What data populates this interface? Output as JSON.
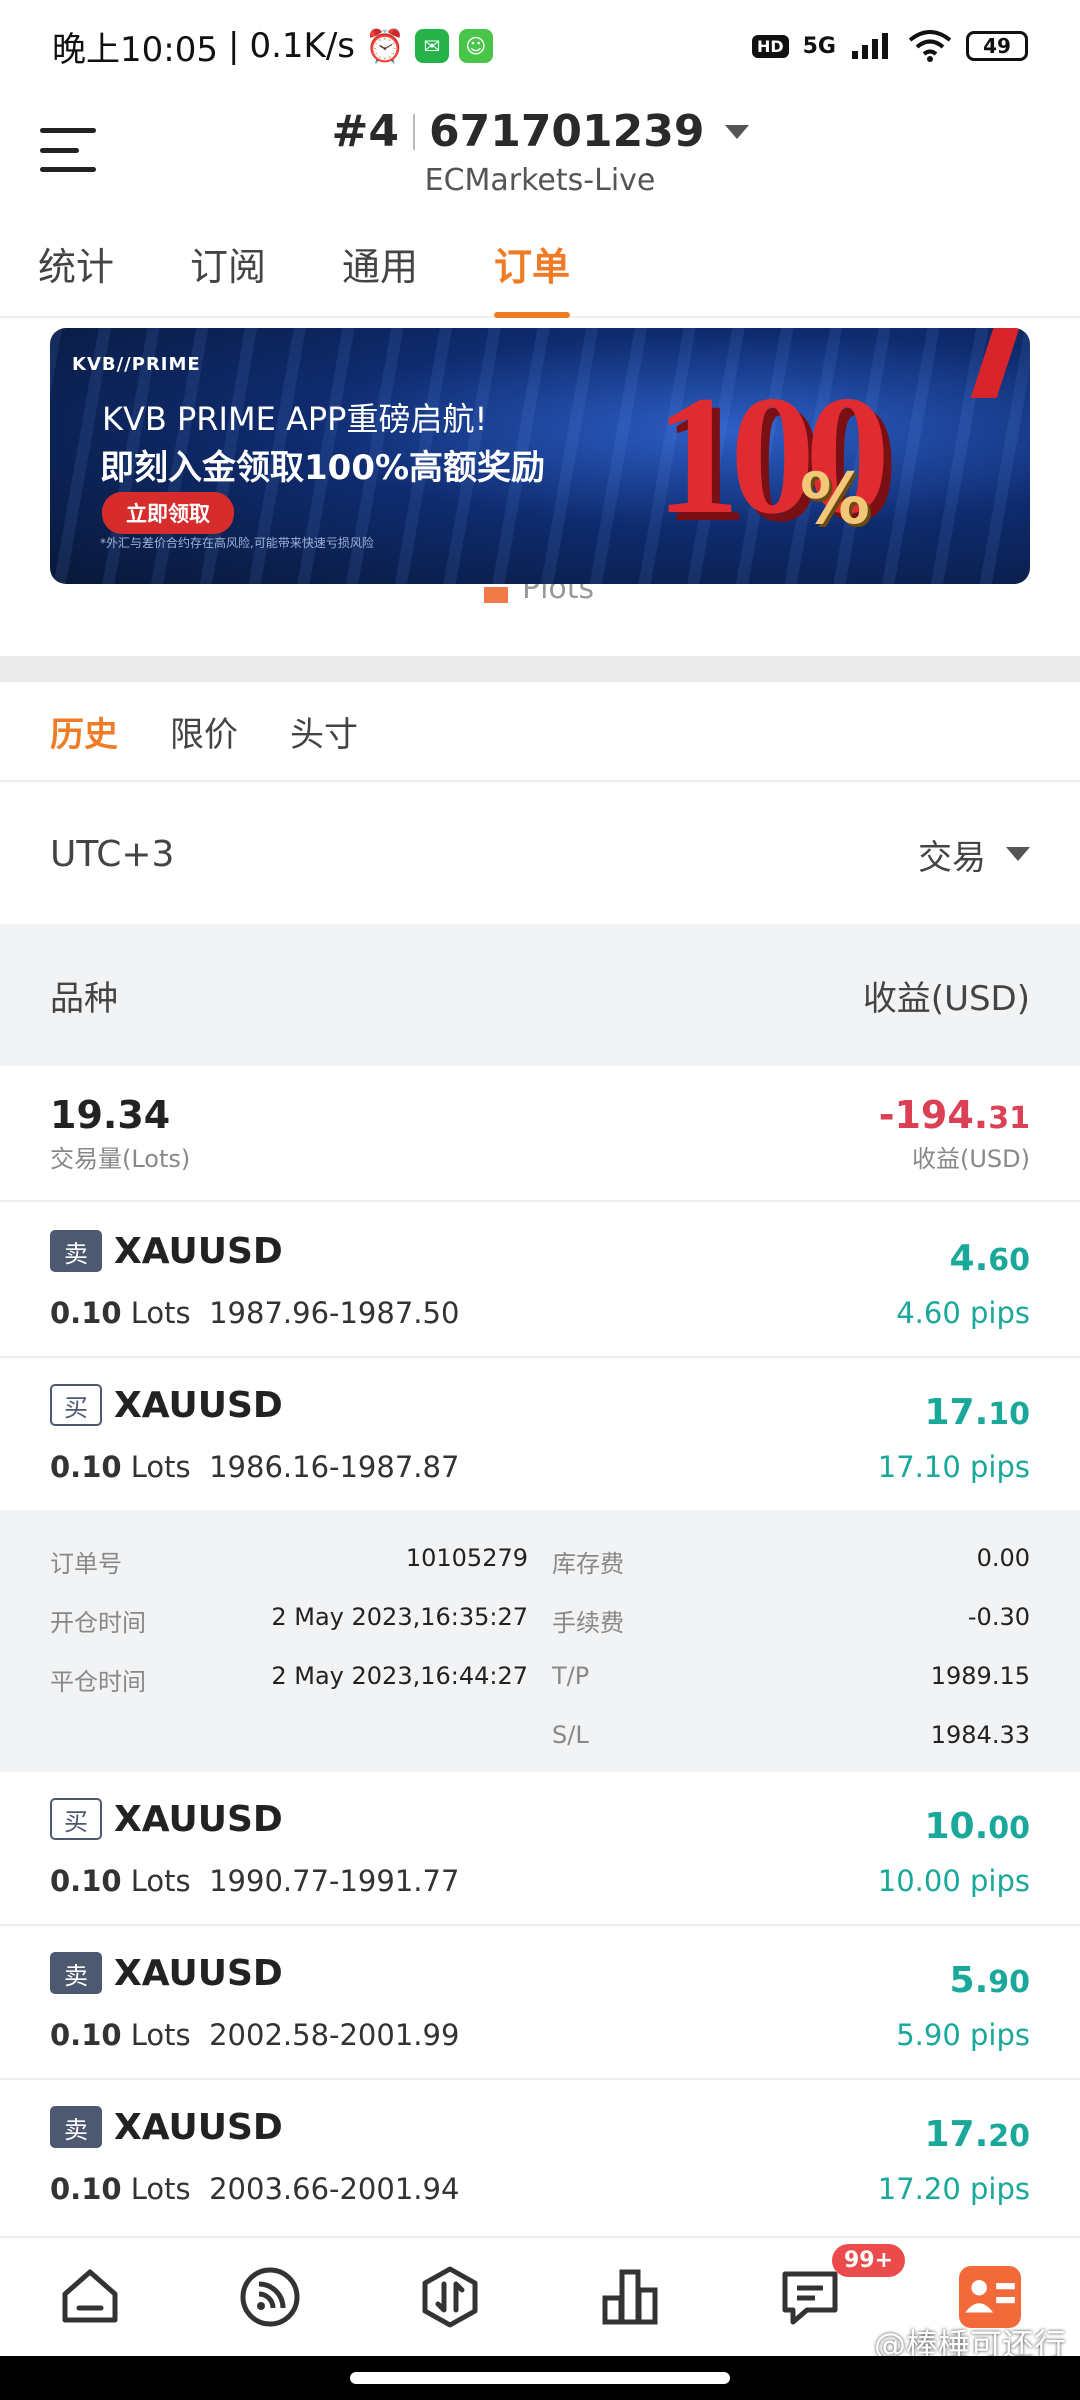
{
  "status_bar": {
    "time": "晚上10:05",
    "speed": "0.1K/s",
    "hd": "HD",
    "network": "5G",
    "battery": "49"
  },
  "header": {
    "account_prefix": "#4",
    "account_number": "671701239",
    "server": "ECMarkets-Live"
  },
  "tabs": [
    "统计",
    "订阅",
    "通用",
    "订单"
  ],
  "banner": {
    "logo": "KVB//PRIME",
    "line1": "KVB PRIME APP重磅启航!",
    "line2": "即刻入金领取100%高额奖励",
    "button": "立即领取",
    "note": "*外汇与差价合约存在高风险,可能带来快速亏损风险",
    "big_number": "100",
    "percent": "%"
  },
  "legend_label": "Plots",
  "subtabs": [
    "历史",
    "限价",
    "头寸"
  ],
  "filter": {
    "timezone": "UTC+3",
    "type_select": "交易"
  },
  "columns": {
    "left": "品种",
    "right": "收益(USD)"
  },
  "summary": {
    "volume": "19.34",
    "volume_label": "交易量(Lots)",
    "profit_main": "-194.",
    "profit_decimals": "31",
    "profit_label": "收益(USD)"
  },
  "orders": [
    {
      "side": "卖",
      "symbol": "XAUUSD",
      "lots": "0.10",
      "lots_unit": "Lots",
      "prices": "1987.96-1987.50",
      "profit_main": "4.",
      "profit_decimals": "60",
      "pips": "4.60 pips"
    },
    {
      "side": "买",
      "symbol": "XAUUSD",
      "lots": "0.10",
      "lots_unit": "Lots",
      "prices": "1986.16-1987.87",
      "profit_main": "17.",
      "profit_decimals": "10",
      "pips": "17.10 pips"
    },
    {
      "side": "买",
      "symbol": "XAUUSD",
      "lots": "0.10",
      "lots_unit": "Lots",
      "prices": "1990.77-1991.77",
      "profit_main": "10.",
      "profit_decimals": "00",
      "pips": "10.00 pips"
    },
    {
      "side": "卖",
      "symbol": "XAUUSD",
      "lots": "0.10",
      "lots_unit": "Lots",
      "prices": "2002.58-2001.99",
      "profit_main": "5.",
      "profit_decimals": "90",
      "pips": "5.90 pips"
    },
    {
      "side": "卖",
      "symbol": "XAUUSD",
      "lots": "0.10",
      "lots_unit": "Lots",
      "prices": "2003.66-2001.94",
      "profit_main": "17.",
      "profit_decimals": "20",
      "pips": "17.20 pips"
    }
  ],
  "details": {
    "order_no_label": "订单号",
    "order_no": "10105279",
    "swap_label": "库存费",
    "swap": "0.00",
    "open_time_label": "开仓时间",
    "open_time": "2 May 2023,16:35:27",
    "commission_label": "手续费",
    "commission": "-0.30",
    "close_time_label": "平仓时间",
    "close_time": "2 May 2023,16:44:27",
    "tp_label": "T/P",
    "tp": "1989.15",
    "sl_label": "S/L",
    "sl": "1984.33"
  },
  "bottom_nav": {
    "messages_badge": "99+",
    "items": [
      "home-icon",
      "feed-icon",
      "trade-icon",
      "chart-bars-icon",
      "messages-icon",
      "profile-icon"
    ]
  },
  "watermark": "@棒棰可还行",
  "colors": {
    "accent": "#f07b25",
    "profit_positive": "#1aa89a",
    "profit_negative": "#dc4055",
    "sell_badge": "#4d5871"
  }
}
